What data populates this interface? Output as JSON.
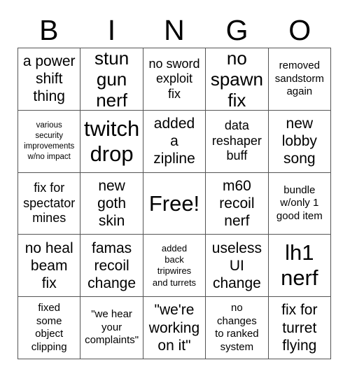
{
  "card": {
    "title": "BINGO",
    "headers": [
      "B",
      "I",
      "N",
      "G",
      "O"
    ],
    "free_space_label": "Free!",
    "colors": {
      "background": "#ffffff",
      "text": "#000000",
      "grid_line": "#555555"
    },
    "rows": [
      [
        {
          "text": "a power\nshift\nthing",
          "size": "l"
        },
        {
          "text": "stun\ngun\nnerf",
          "size": "xl"
        },
        {
          "text": "no sword\nexploit\nfix",
          "size": "m"
        },
        {
          "text": "no\nspawn\nfix",
          "size": "xl"
        },
        {
          "text": "removed\nsandstorm\nagain",
          "size": "s"
        }
      ],
      [
        {
          "text": "various\nsecurity\nimprovements\nw/no impact",
          "size": "xxs"
        },
        {
          "text": "twitch\ndrop",
          "size": "xxl"
        },
        {
          "text": "added\na\nzipline",
          "size": "l"
        },
        {
          "text": "data\nreshaper\nbuff",
          "size": "m"
        },
        {
          "text": "new\nlobby\nsong",
          "size": "l"
        }
      ],
      [
        {
          "text": "fix for\nspectator\nmines",
          "size": "m"
        },
        {
          "text": "new\ngoth\nskin",
          "size": "l"
        },
        {
          "text": "Free!",
          "size": "xxl"
        },
        {
          "text": "m60\nrecoil\nnerf",
          "size": "l"
        },
        {
          "text": "bundle\nw/only 1\ngood item",
          "size": "s"
        }
      ],
      [
        {
          "text": "no heal\nbeam\nfix",
          "size": "l"
        },
        {
          "text": "famas\nrecoil\nchange",
          "size": "l"
        },
        {
          "text": "added\nback\ntripwires\nand turrets",
          "size": "xs"
        },
        {
          "text": "useless\nUI\nchange",
          "size": "l"
        },
        {
          "text": "lh1\nnerf",
          "size": "xxl"
        }
      ],
      [
        {
          "text": "fixed\nsome\nobject\nclipping",
          "size": "s"
        },
        {
          "text": "\"we hear\nyour\ncomplaints\"",
          "size": "s"
        },
        {
          "text": "\"we're\nworking\non it\"",
          "size": "l"
        },
        {
          "text": "no\nchanges\nto ranked\nsystem",
          "size": "s"
        },
        {
          "text": "fix for\nturret\nflying",
          "size": "l"
        }
      ]
    ]
  }
}
